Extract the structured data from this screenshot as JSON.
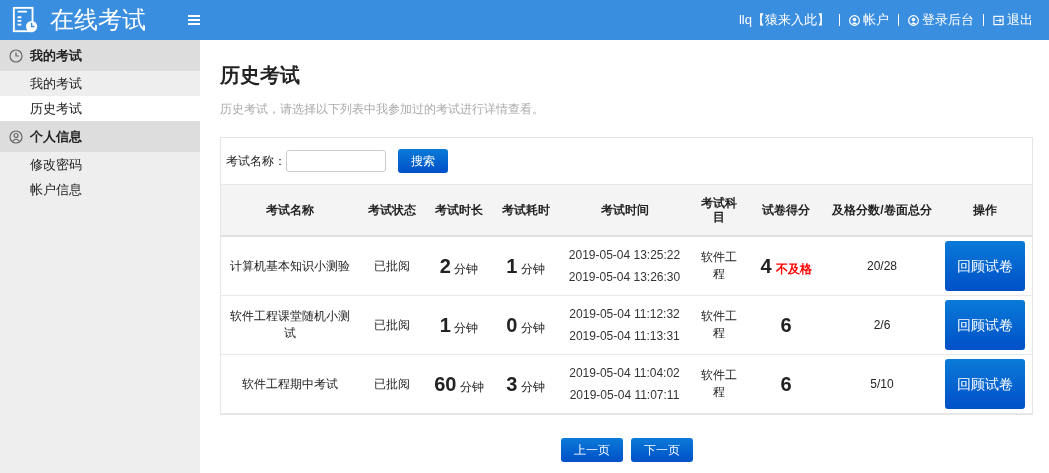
{
  "header": {
    "title": "在线考试",
    "user": "llq【猿来入此】",
    "links": [
      {
        "kind": "user",
        "label": "帐户"
      },
      {
        "kind": "user",
        "label": "登录后台"
      },
      {
        "kind": "logout",
        "label": "退出"
      }
    ]
  },
  "sidebar": {
    "groups": [
      {
        "kind": "clock",
        "label": "我的考试",
        "items": [
          {
            "label": "我的考试",
            "selected": false
          },
          {
            "label": "历史考试",
            "selected": true
          }
        ]
      },
      {
        "kind": "person",
        "label": "个人信息",
        "items": [
          {
            "label": "修改密码",
            "selected": false
          },
          {
            "label": "帐户信息",
            "selected": false
          }
        ]
      }
    ]
  },
  "page": {
    "title": "历史考试",
    "description": "历史考试，请选择以下列表中我参加过的考试进行详情查看。"
  },
  "search": {
    "label": "考试名称：",
    "button": "搜索"
  },
  "table": {
    "columns": [
      "考试名称",
      "考试状态",
      "考试时长",
      "考试耗时",
      "考试时间",
      "考试科目",
      "试卷得分",
      "及格分数/卷面总分",
      "操作"
    ],
    "rows": [
      {
        "name": "计算机基本知识小测验",
        "status": "已批阅",
        "duration": "2",
        "duration_unit": "分钟",
        "used": "1",
        "used_unit": "分钟",
        "start": "2019-05-04 13:25:22",
        "end": "2019-05-04 13:26:30",
        "subject": "软件工程",
        "score": "4",
        "verdict": "不及格",
        "pass_total": "20/28",
        "action": "回顾试卷"
      },
      {
        "name": "软件工程课堂随机小测试",
        "status": "已批阅",
        "duration": "1",
        "duration_unit": "分钟",
        "used": "0",
        "used_unit": "分钟",
        "start": "2019-05-04 11:12:32",
        "end": "2019-05-04 11:13:31",
        "subject": "软件工程",
        "score": "6",
        "pass_total": "2/6",
        "action": "回顾试卷"
      },
      {
        "name": "软件工程期中考试",
        "status": "已批阅",
        "duration": "60",
        "duration_unit": "分钟",
        "used": "3",
        "used_unit": "分钟",
        "start": "2019-05-04 11:04:02",
        "end": "2019-05-04 11:07:11",
        "subject": "软件工程",
        "score": "6",
        "pass_total": "5/10",
        "action": "回顾试卷"
      }
    ]
  },
  "pagination": [
    "上一页",
    "下一页"
  ]
}
